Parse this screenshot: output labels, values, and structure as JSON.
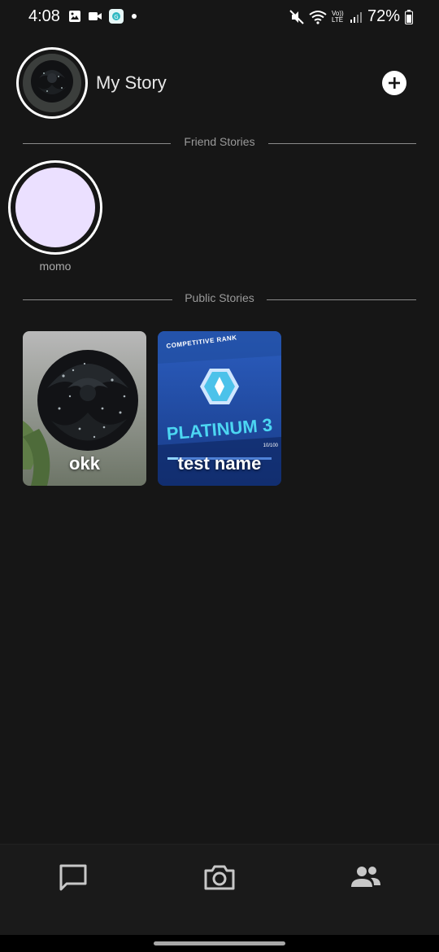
{
  "status_bar": {
    "time": "4:08",
    "battery_percent": "72%",
    "icons_left": [
      "gallery-icon",
      "video-icon",
      "app-icon",
      "dot-icon"
    ],
    "icons_right": [
      "mute-icon",
      "wifi-icon",
      "volte-icon",
      "signal-icon",
      "battery-icon"
    ],
    "volte_text": "Vo)) LTE"
  },
  "my_story": {
    "label": "My Story"
  },
  "sections": {
    "friend_stories": "Friend Stories",
    "public_stories": "Public Stories"
  },
  "friends": [
    {
      "name": "momo",
      "avatar_color": "#ebe0ff"
    }
  ],
  "public_stories": [
    {
      "label": "okk"
    },
    {
      "label": "test name",
      "rank_title": "COMPETITIVE RANK",
      "rank_name": "PLATINUM 3",
      "progress": "10/100"
    }
  ],
  "bottom_nav": {
    "items": [
      "chat-icon",
      "camera-icon",
      "friends-icon"
    ]
  },
  "colors": {
    "background": "#161616",
    "nav_background": "#1a1a1a",
    "accent": "#ffffff",
    "divider": "#8a8a8a"
  }
}
